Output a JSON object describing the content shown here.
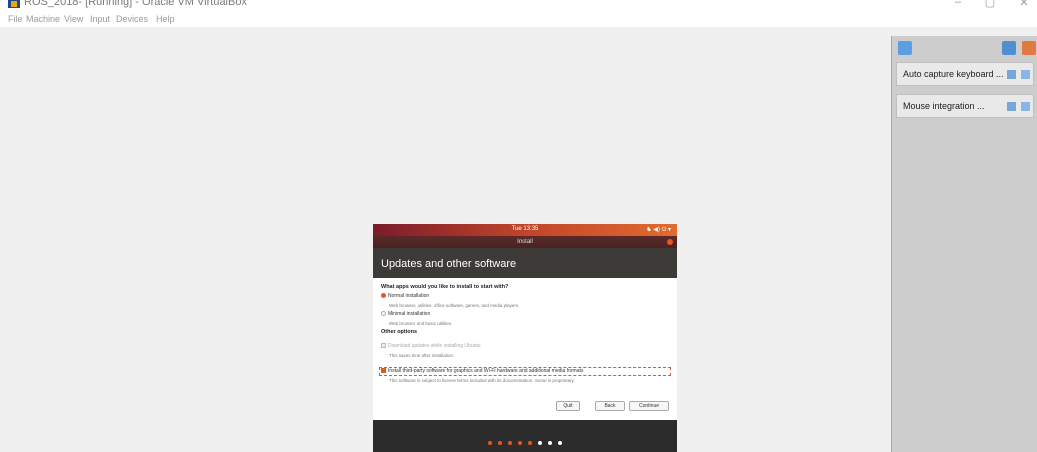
{
  "window": {
    "title": "ROS_2018- [Running] - Oracle VM VirtualBox",
    "minimize": "–",
    "restore": "▢",
    "close": "✕"
  },
  "menu": [
    "File",
    "Machine",
    "View",
    "Input",
    "Devices",
    "Help"
  ],
  "side_panel": {
    "cards": [
      {
        "label": "Auto capture keyboard ..."
      },
      {
        "label": "Mouse integration ..."
      }
    ]
  },
  "ubuntu": {
    "time": "Tue 13:35",
    "tray": "♞  ◀)  ⏻  ▾",
    "window_title": "Install",
    "heading": "Updates and other software",
    "question": "What apps would you like to install to start with?",
    "normal": "Normal installation",
    "normal_desc": "Web browser, utilities, office software, games, and media players.",
    "minimal": "Minimal installation",
    "minimal_desc": "Web browser and basic utilities.",
    "other_options": "Other options",
    "download_updates": "Download updates while installing Ubuntu",
    "download_desc": "This saves time after installation.",
    "third_party": "Install third-party software for graphics and Wi-Fi hardware and additional media formats",
    "third_party_desc": "This software is subject to license terms included with its documentation. Some is proprietary.",
    "quit": "Quit",
    "back": "Back",
    "continue": "Continue",
    "progress_steps_done": 5,
    "progress_steps_total": 8
  },
  "colors": {
    "accent": "#e95420",
    "header": "#3c3b37"
  }
}
